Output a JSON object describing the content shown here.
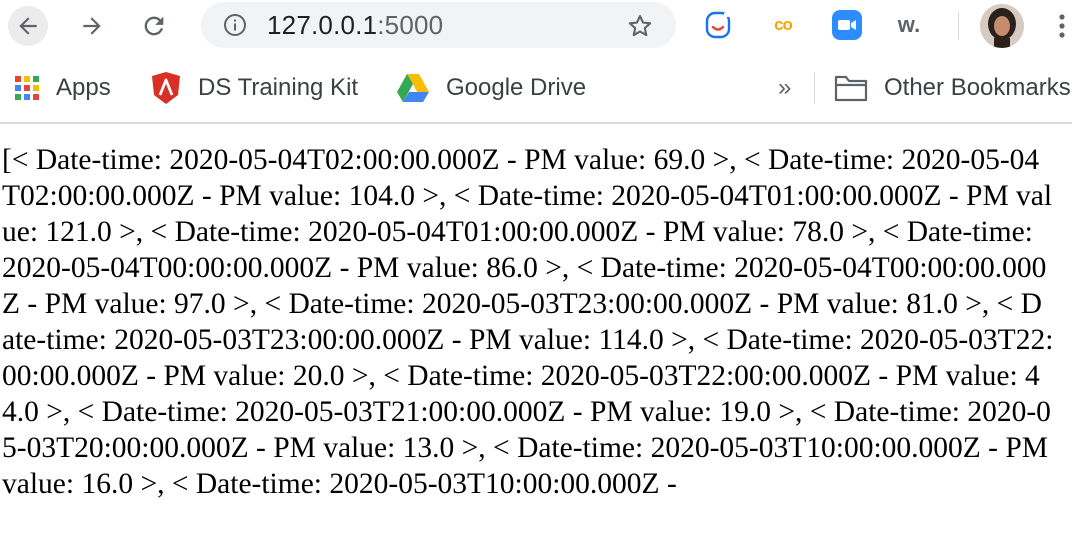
{
  "browser": {
    "url_host": "127.0.0.1",
    "url_port": ":5000"
  },
  "extensions": {
    "co_label": "co",
    "w_label": "w."
  },
  "bookmarks": {
    "items": [
      {
        "label": "Apps"
      },
      {
        "label": "DS Training Kit"
      },
      {
        "label": "Google Drive"
      }
    ],
    "overflow": "»",
    "other_label": "Other Bookmarks"
  },
  "page": {
    "content_text": "[< Date-time: 2020-05-04T02:00:00.000Z - PM value: 69.0 >, < Date-time: 2020-05-04T02:00:00.000Z - PM value: 104.0 >, < Date-time: 2020-05-04T01:00:00.000Z - PM value: 121.0 >, < Date-time: 2020-05-04T01:00:00.000Z - PM value: 78.0 >, < Date-time: 2020-05-04T00:00:00.000Z - PM value: 86.0 >, < Date-time: 2020-05-04T00:00:00.000Z - PM value: 97.0 >, < Date-time: 2020-05-03T23:00:00.000Z - PM value: 81.0 >, < Date-time: 2020-05-03T23:00:00.000Z - PM value: 114.0 >, < Date-time: 2020-05-03T22:00:00.000Z - PM value: 20.0 >, < Date-time: 2020-05-03T22:00:00.000Z - PM value: 44.0 >, < Date-time: 2020-05-03T21:00:00.000Z - PM value: 19.0 >, < Date-time: 2020-05-03T20:00:00.000Z - PM value: 13.0 >, < Date-time: 2020-05-03T10:00:00.000Z - PM value: 16.0 >, < Date-time: 2020-05-03T10:00:00.000Z -"
  },
  "colors": {
    "accent_blue": "#1a73e8",
    "zoom_blue": "#2d8cff",
    "co_orange": "#f4a700",
    "ds_red": "#d93025"
  },
  "icons": [
    "back-arrow-icon",
    "forward-arrow-icon",
    "reload-icon",
    "info-icon",
    "star-icon",
    "smiley-extension-icon",
    "zoom-icon",
    "apps-grid-icon",
    "ds-shield-icon",
    "google-drive-icon",
    "folder-icon",
    "kebab-menu-icon"
  ]
}
